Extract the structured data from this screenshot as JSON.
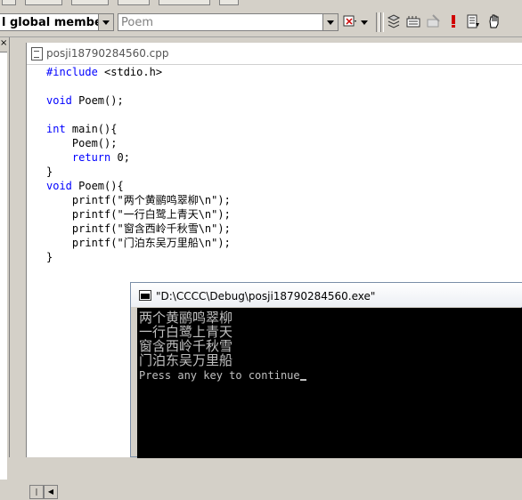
{
  "toolbar": {
    "members_combo": "l global members",
    "function_combo": "Poem",
    "icons": [
      "wizard-dropdown-icon",
      "compile-icon",
      "build-icon",
      "stop-build-icon",
      "execute-icon",
      "go-icon",
      "breakpoint-hand-icon"
    ]
  },
  "leftpanel": {
    "close_glyph": "×"
  },
  "editor": {
    "filename": "posji18790284560.cpp",
    "lines": [
      "#include <stdio.h>",
      "",
      "void Poem();",
      "",
      "int main(){",
      "    Poem();",
      "    return 0;",
      "}",
      "void Poem(){",
      "    printf(\"两个黄鹂鸣翠柳\\n\");",
      "    printf(\"一行白鹭上青天\\n\");",
      "    printf(\"窗含西岭千秋雪\\n\");",
      "    printf(\"门泊东吴万里船\\n\");",
      "}"
    ]
  },
  "console": {
    "title": "\"D:\\CCCC\\Debug\\posji18790284560.exe\"",
    "output": [
      "两个黄鹂鸣翠柳",
      "一行白鹭上青天",
      "窗含西岭千秋雪",
      "门泊东吴万里船"
    ],
    "prompt": "Press any key to continue"
  },
  "colors": {
    "keyword": "#0000ff",
    "console_bg": "#000000",
    "console_text": "#c0c0c0"
  }
}
